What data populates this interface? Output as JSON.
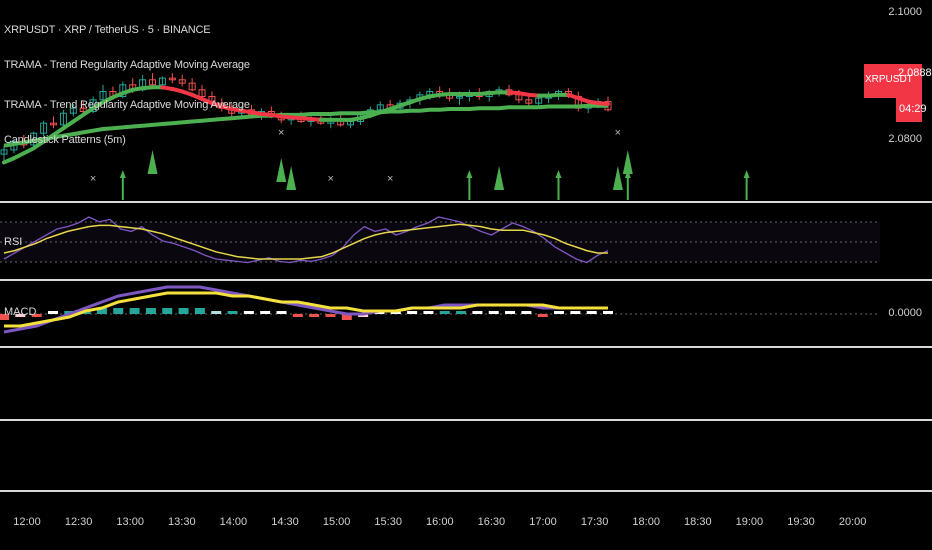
{
  "symbol_line": "XRPUSDT · XRP / TetherUS · 5 · BINANCE",
  "indicators": [
    "TRAMA - Trend Regularity Adaptive Moving Average",
    "TRAMA - Trend Regularity Adaptive Moving Average",
    "Candlestick Patterns (5m)"
  ],
  "panes": {
    "rsi_label": "RSI",
    "macd_label": "MACD"
  },
  "price_axis": {
    "top_label": "2.1000",
    "bottom_label": "2.0800",
    "macd_zero": "0.0000"
  },
  "price_tag": {
    "symbol": "XRPUSDT",
    "price": "2.0888",
    "countdown": "04:29"
  },
  "colors": {
    "bull": "#26a69a",
    "bear": "#ef5350",
    "trama_fast_up": "#4caf50",
    "trama_fast_down": "#f23645",
    "trama_slow": "#4caf50",
    "rsi": "#7e57c2",
    "rsi_ma": "#e6d54a",
    "macd": "#7e57c2",
    "signal": "#f5e13c",
    "arrow": "#4caf50"
  },
  "chart_data": {
    "type": "candlestick",
    "x_ticks": [
      "12:00",
      "12:30",
      "13:00",
      "13:30",
      "14:00",
      "14:30",
      "15:00",
      "15:30",
      "16:00",
      "16:30",
      "17:00",
      "17:30",
      "18:00",
      "18:30",
      "19:00",
      "19:30",
      "20:00"
    ],
    "price_range": [
      2.078,
      2.101
    ],
    "candles": [
      [
        2.0835,
        2.0845,
        2.0825,
        2.084
      ],
      [
        2.084,
        2.0852,
        2.0836,
        2.085
      ],
      [
        2.085,
        2.0858,
        2.0842,
        2.0846
      ],
      [
        2.0846,
        2.0862,
        2.0844,
        2.086
      ],
      [
        2.086,
        2.0875,
        2.0856,
        2.0872
      ],
      [
        2.0872,
        2.088,
        2.0866,
        2.087
      ],
      [
        2.087,
        2.0888,
        2.0868,
        2.0884
      ],
      [
        2.0884,
        2.0895,
        2.088,
        2.089
      ],
      [
        2.089,
        2.0898,
        2.0884,
        2.0886
      ],
      [
        2.0886,
        2.0904,
        2.0884,
        2.09
      ],
      [
        2.09,
        2.0918,
        2.0896,
        2.091
      ],
      [
        2.091,
        2.0916,
        2.09,
        2.0904
      ],
      [
        2.0904,
        2.0922,
        2.0902,
        2.0918
      ],
      [
        2.0918,
        2.0926,
        2.0908,
        2.0912
      ],
      [
        2.0912,
        2.093,
        2.091,
        2.0924
      ],
      [
        2.0924,
        2.0932,
        2.0914,
        2.0918
      ],
      [
        2.0918,
        2.0928,
        2.0912,
        2.0926
      ],
      [
        2.0926,
        2.0932,
        2.092,
        2.0924
      ],
      [
        2.0924,
        2.093,
        2.0916,
        2.092
      ],
      [
        2.092,
        2.0926,
        2.091,
        2.0912
      ],
      [
        2.0912,
        2.0918,
        2.09,
        2.0904
      ],
      [
        2.0904,
        2.091,
        2.0892,
        2.0896
      ],
      [
        2.0896,
        2.0902,
        2.0886,
        2.089
      ],
      [
        2.089,
        2.0896,
        2.088,
        2.0884
      ],
      [
        2.0884,
        2.0892,
        2.0878,
        2.0888
      ],
      [
        2.0888,
        2.0894,
        2.088,
        2.0882
      ],
      [
        2.0882,
        2.089,
        2.0876,
        2.0886
      ],
      [
        2.0886,
        2.0892,
        2.0878,
        2.088
      ],
      [
        2.088,
        2.0886,
        2.0872,
        2.0876
      ],
      [
        2.0876,
        2.0884,
        2.087,
        2.088
      ],
      [
        2.088,
        2.0886,
        2.0872,
        2.0874
      ],
      [
        2.0874,
        2.0882,
        2.0868,
        2.0878
      ],
      [
        2.0878,
        2.0884,
        2.087,
        2.0872
      ],
      [
        2.0872,
        2.088,
        2.0866,
        2.0876
      ],
      [
        2.0876,
        2.0882,
        2.0868,
        2.087
      ],
      [
        2.087,
        2.0878,
        2.0866,
        2.0874
      ],
      [
        2.0874,
        2.0884,
        2.087,
        2.0882
      ],
      [
        2.0882,
        2.0892,
        2.0878,
        2.0888
      ],
      [
        2.0888,
        2.0898,
        2.0884,
        2.0894
      ],
      [
        2.0894,
        2.09,
        2.0886,
        2.089
      ],
      [
        2.089,
        2.09,
        2.0886,
        2.0896
      ],
      [
        2.0896,
        2.0904,
        2.089,
        2.09
      ],
      [
        2.09,
        2.091,
        2.0894,
        2.0906
      ],
      [
        2.0906,
        2.0914,
        2.09,
        2.091
      ],
      [
        2.091,
        2.0916,
        2.0902,
        2.0906
      ],
      [
        2.0906,
        2.0914,
        2.0898,
        2.0902
      ],
      [
        2.0902,
        2.091,
        2.0894,
        2.0904
      ],
      [
        2.0904,
        2.0912,
        2.0898,
        2.0908
      ],
      [
        2.0908,
        2.0914,
        2.09,
        2.0904
      ],
      [
        2.0904,
        2.0912,
        2.0898,
        2.091
      ],
      [
        2.091,
        2.0916,
        2.0904,
        2.0912
      ],
      [
        2.0912,
        2.0918,
        2.0904,
        2.0906
      ],
      [
        2.0906,
        2.0912,
        2.0896,
        2.09
      ],
      [
        2.09,
        2.0908,
        2.0892,
        2.0896
      ],
      [
        2.0896,
        2.0904,
        2.089,
        2.0902
      ],
      [
        2.0902,
        2.091,
        2.0896,
        2.0906
      ],
      [
        2.0906,
        2.0912,
        2.09,
        2.091
      ],
      [
        2.091,
        2.0914,
        2.0902,
        2.0904
      ],
      [
        2.0904,
        2.091,
        2.0886,
        2.089
      ],
      [
        2.089,
        2.0898,
        2.0884,
        2.0894
      ],
      [
        2.0894,
        2.0902,
        2.089,
        2.0898
      ],
      [
        2.0898,
        2.0904,
        2.0886,
        2.0888
      ]
    ],
    "trama_fast": [
      2.0825,
      2.083,
      2.0836,
      2.0842,
      2.085,
      2.0858,
      2.0866,
      2.0874,
      2.0882,
      2.089,
      2.0897,
      2.0903,
      2.0908,
      2.0912,
      2.0914,
      2.0915,
      2.0915,
      2.0913,
      2.091,
      2.0906,
      2.0901,
      2.0896,
      2.0892,
      2.0889,
      2.0887,
      2.0885,
      2.0883,
      2.0882,
      2.088,
      2.0879,
      2.0878,
      2.0877,
      2.0876,
      2.0876,
      2.0876,
      2.0876,
      2.0878,
      2.0881,
      2.0885,
      2.0889,
      2.0893,
      2.0897,
      2.0901,
      2.0904,
      2.0906,
      2.0907,
      2.0907,
      2.0907,
      2.0907,
      2.0908,
      2.0909,
      2.0909,
      2.0908,
      2.0906,
      2.0905,
      2.0905,
      2.0906,
      2.0906,
      2.0902,
      2.0898,
      2.0896,
      2.0895
    ],
    "trama_slow": [
      2.0845,
      2.0847,
      2.0849,
      2.0851,
      2.0853,
      2.0855,
      2.0857,
      2.0859,
      2.0861,
      2.0863,
      2.0865,
      2.0866,
      2.0867,
      2.0868,
      2.0869,
      2.087,
      2.0871,
      2.0872,
      2.0873,
      2.0874,
      2.0875,
      2.0876,
      2.0877,
      2.0878,
      2.0879,
      2.088,
      2.0881,
      2.0881,
      2.0882,
      2.0882,
      2.0882,
      2.0883,
      2.0883,
      2.0883,
      2.0884,
      2.0884,
      2.0884,
      2.0885,
      2.0885,
      2.0886,
      2.0886,
      2.0887,
      2.0887,
      2.0888,
      2.0888,
      2.0889,
      2.0889,
      2.0889,
      2.089,
      2.089,
      2.089,
      2.0891,
      2.0891,
      2.0891,
      2.0891,
      2.0892,
      2.0892,
      2.0892,
      2.0892,
      2.0893,
      2.0893,
      2.0893
    ],
    "pattern_arrows_big": [
      15,
      28,
      29,
      50,
      62,
      63
    ],
    "pattern_arrows_small": [
      12,
      47,
      56,
      63,
      75
    ],
    "pattern_crosses": [
      9,
      28,
      33,
      39,
      62
    ],
    "rsi": [
      35,
      40,
      45,
      50,
      55,
      60,
      62,
      65,
      70,
      66,
      68,
      60,
      58,
      62,
      55,
      50,
      48,
      45,
      42,
      38,
      35,
      34,
      33,
      32,
      34,
      36,
      33,
      32,
      34,
      33,
      35,
      38,
      45,
      55,
      62,
      58,
      60,
      55,
      58,
      62,
      65,
      70,
      68,
      66,
      62,
      58,
      55,
      60,
      65,
      62,
      58,
      52,
      45,
      40,
      35,
      32,
      38,
      42
    ],
    "rsi_ma": [
      40,
      42,
      45,
      48,
      52,
      55,
      58,
      60,
      62,
      63,
      63,
      62,
      61,
      60,
      58,
      56,
      53,
      50,
      47,
      44,
      41,
      39,
      37,
      36,
      35,
      35,
      35,
      35,
      35,
      36,
      37,
      40,
      44,
      48,
      52,
      55,
      57,
      58,
      59,
      60,
      61,
      62,
      63,
      64,
      63,
      62,
      60,
      59,
      59,
      59,
      57,
      55,
      52,
      48,
      45,
      42,
      40,
      40
    ],
    "macd": [
      -0.0006,
      -0.0005,
      -0.0004,
      -0.0002,
      0.0,
      0.0002,
      0.0004,
      0.0006,
      0.0007,
      0.0008,
      0.0009,
      0.0009,
      0.0009,
      0.0008,
      0.0007,
      0.0006,
      0.0005,
      0.0004,
      0.0003,
      0.0002,
      0.0001,
      0.0,
      0.0,
      0.0001,
      0.0001,
      0.0002,
      0.0002,
      0.0003,
      0.0003,
      0.0003,
      0.0003,
      0.0003,
      0.0003,
      0.0002,
      0.0002,
      0.0002,
      0.0002,
      0.0002
    ],
    "signal": [
      -0.0004,
      -0.0004,
      -0.0003,
      -0.0002,
      -0.0001,
      0.0001,
      0.0002,
      0.0004,
      0.0005,
      0.0006,
      0.0007,
      0.0007,
      0.0007,
      0.0007,
      0.0006,
      0.0006,
      0.0005,
      0.0004,
      0.0004,
      0.0003,
      0.0002,
      0.0002,
      0.0001,
      0.0001,
      0.0001,
      0.0002,
      0.0002,
      0.0002,
      0.0002,
      0.0003,
      0.0003,
      0.0003,
      0.0003,
      0.0003,
      0.0002,
      0.0002,
      0.0002,
      0.0002
    ],
    "histogram": [
      -0.0002,
      -0.0001,
      -0.0001,
      0.0,
      0.0001,
      0.0001,
      0.0002,
      0.0002,
      0.0002,
      0.0002,
      0.0002,
      0.0002,
      0.0002,
      0.0001,
      0.0001,
      0.0,
      0.0,
      0.0,
      -0.0001,
      -0.0001,
      -0.0001,
      -0.0002,
      -0.0001,
      0.0,
      0.0,
      0.0,
      0.0,
      0.0001,
      0.0001,
      0.0,
      0.0,
      0.0,
      0.0,
      -0.0001,
      0.0,
      0.0,
      0.0,
      0.0
    ]
  }
}
